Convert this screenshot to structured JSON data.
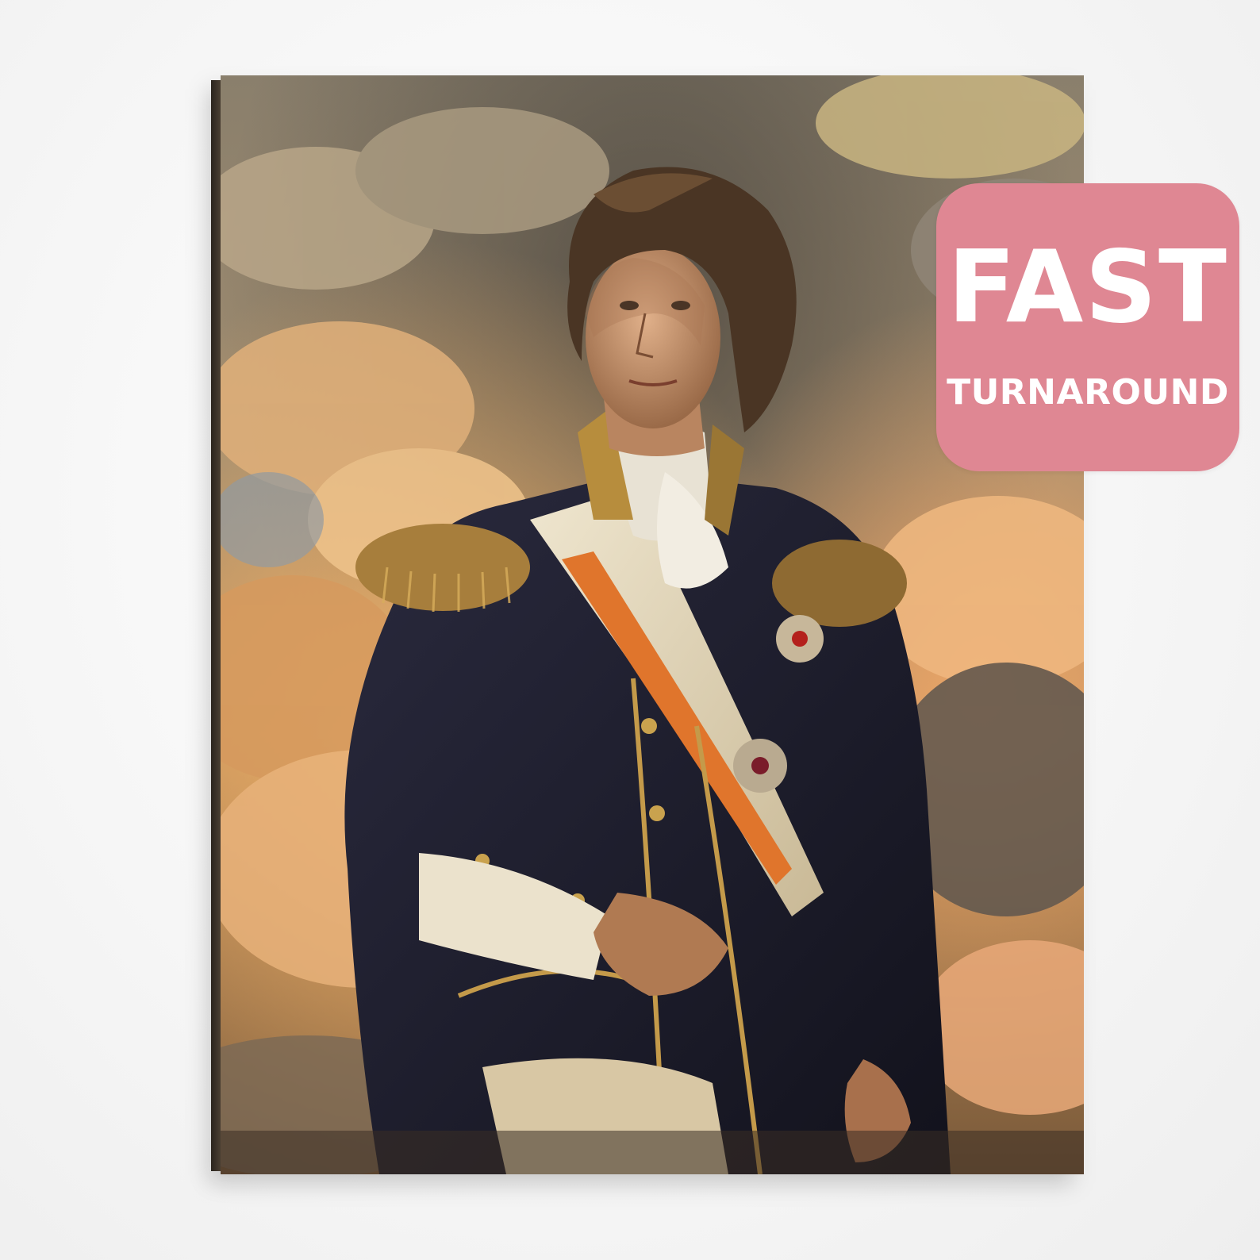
{
  "badge": {
    "title": "FAST",
    "subtitle": "TURNAROUND",
    "color": "#df8793"
  },
  "artwork": {
    "subject": "oil-painting-portrait-icon"
  }
}
